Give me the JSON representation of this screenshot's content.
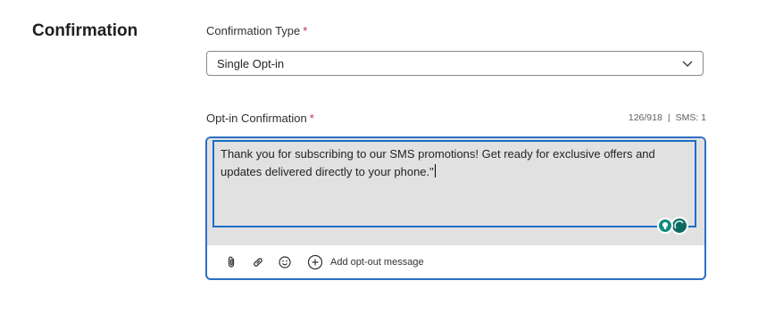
{
  "section": {
    "title": "Confirmation"
  },
  "confirmation_type": {
    "label": "Confirmation Type",
    "required_mark": "*",
    "selected_value": "Single Opt-in"
  },
  "optin": {
    "label": "Opt-in Confirmation",
    "required_mark": "*",
    "char_count": "126/918",
    "separator": "|",
    "sms_count": "SMS: 1",
    "message": "Thank you for subscribing to our SMS promotions! Get ready for exclusive offers and updates delivered directly to your phone.\""
  },
  "toolbar": {
    "icons": [
      "paperclip-icon",
      "link-icon",
      "emoji-icon",
      "add-circle-icon"
    ],
    "add_optout_label": "Add opt-out message"
  },
  "colors": {
    "focus_border": "#2f6fc4",
    "required": "#c4314b",
    "assistant": "#0f8a80"
  }
}
